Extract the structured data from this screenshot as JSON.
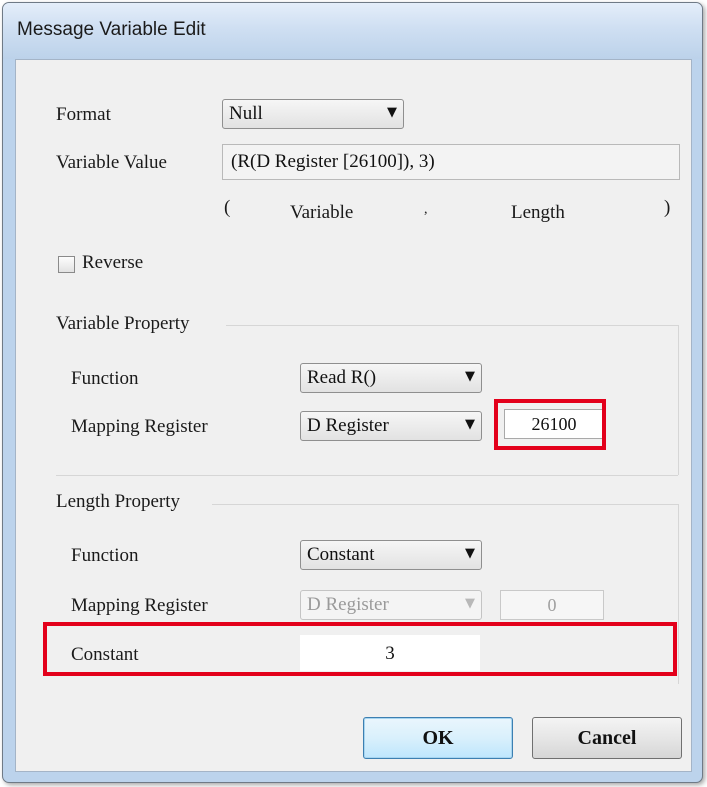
{
  "window": {
    "title": "Message Variable Edit"
  },
  "format": {
    "label": "Format",
    "value": "Null"
  },
  "variable_value": {
    "label": "Variable Value",
    "value": "(R(D Register [26100]), 3)",
    "hint_open": "(",
    "hint_variable": "Variable",
    "hint_sep": ",",
    "hint_length": "Length",
    "hint_close": ")"
  },
  "reverse": {
    "label": "Reverse",
    "checked": false
  },
  "variable_property": {
    "title": "Variable Property",
    "function_label": "Function",
    "function_value": "Read R()",
    "mapping_label": "Mapping Register",
    "mapping_value": "D Register",
    "address_value": "26100"
  },
  "length_property": {
    "title": "Length Property",
    "function_label": "Function",
    "function_value": "Constant",
    "mapping_label": "Mapping Register",
    "mapping_value": "D Register",
    "address_value": "0",
    "constant_label": "Constant",
    "constant_value": "3"
  },
  "buttons": {
    "ok": "OK",
    "cancel": "Cancel"
  },
  "colors": {
    "highlight": "#e3001b",
    "title_bar": "#cfdff2",
    "client_bg": "#f0f0f0"
  },
  "icons": {
    "dropdown": "chevron-down-icon",
    "checkbox": "checkbox-icon"
  }
}
